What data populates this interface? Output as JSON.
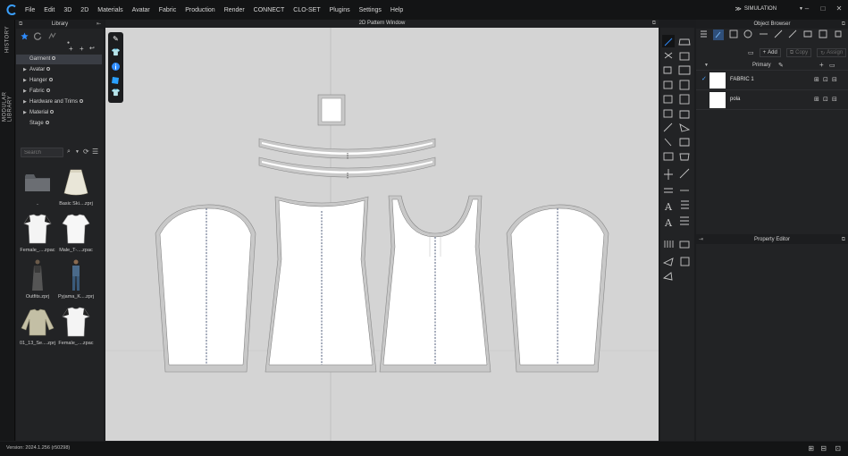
{
  "menu": {
    "items": [
      "File",
      "Edit",
      "3D",
      "2D",
      "Materials",
      "Avatar",
      "Fabric",
      "Production",
      "Render",
      "CONNECT",
      "CLO-SET",
      "Plugins",
      "Settings",
      "Help"
    ],
    "mode": "SIMULATION"
  },
  "side_tabs": {
    "history": "HISTORY",
    "modular": "MODULAR LIBRARY"
  },
  "library": {
    "title": "Library",
    "tree": [
      {
        "label": "Garment",
        "selected": true,
        "expandable": false
      },
      {
        "label": "Avatar",
        "selected": false,
        "expandable": true
      },
      {
        "label": "Hanger",
        "selected": false,
        "expandable": true
      },
      {
        "label": "Fabric",
        "selected": false,
        "expandable": true
      },
      {
        "label": "Hardware and Trims",
        "selected": false,
        "expandable": true
      },
      {
        "label": "Material",
        "selected": false,
        "expandable": true
      },
      {
        "label": "Stage",
        "selected": false,
        "expandable": false
      }
    ],
    "search_placeholder": "Search",
    "thumbs": [
      {
        "caption": "..",
        "icon": "folder-icon"
      },
      {
        "caption": "Basic Ski....zprj",
        "icon": "skirt-thumbnail"
      },
      {
        "caption": "Female_....zpac",
        "icon": "tshirt-thumbnail"
      },
      {
        "caption": "Male_T-....zpac",
        "icon": "tshirt-thumbnail"
      },
      {
        "caption": "Outfits.zprj",
        "icon": "dress-avatar-thumbnail"
      },
      {
        "caption": "Pyjama_K....zprj",
        "icon": "pyjama-avatar-thumbnail"
      },
      {
        "caption": "01_13_Se....zprj",
        "icon": "sweater-thumbnail"
      },
      {
        "caption": "Female_....zpac",
        "icon": "tshirt-thumbnail"
      }
    ]
  },
  "pattern_window": {
    "title": "2D Pattern Window"
  },
  "object_browser": {
    "title": "Object Browser",
    "add_label": "Add",
    "copy_label": "Copy",
    "assign_label": "Assign",
    "group_label": "Primary",
    "fabrics": [
      {
        "name": "FABRIC 1",
        "checked": true
      },
      {
        "name": "pola",
        "checked": false
      }
    ]
  },
  "property_editor": {
    "title": "Property Editor"
  },
  "status": {
    "version": "Version: 2024.1.256 (r50298)"
  },
  "colors": {
    "accent": "#2f8cff",
    "canvas": "#d4d4d4",
    "panel": "#222325",
    "bar": "#131415"
  }
}
